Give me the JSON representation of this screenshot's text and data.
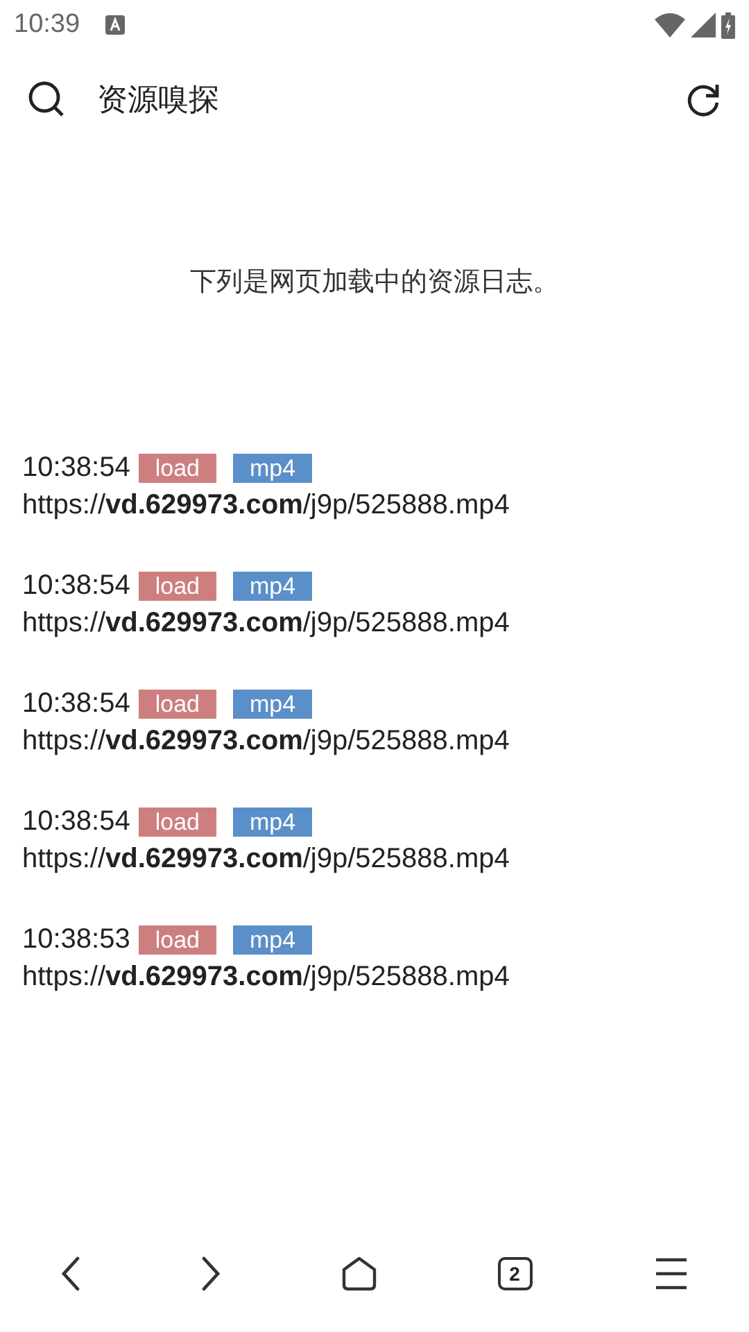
{
  "status_bar": {
    "time": "10:39"
  },
  "header": {
    "title": "资源嗅探"
  },
  "intro": "下列是网页加载中的资源日志。",
  "entries": [
    {
      "time": "10:38:54",
      "tags": [
        {
          "label": "load",
          "color": "#cd7f80"
        },
        {
          "label": "mp4",
          "color": "#5b8fc9"
        }
      ],
      "url": "https://**vd.629973.com**/j9p/525888.mp4"
    },
    {
      "time": "10:38:54",
      "tags": [
        {
          "label": "load",
          "color": "#cd7f80"
        },
        {
          "label": "mp4",
          "color": "#5b8fc9"
        }
      ],
      "url": "https://**vd.629973.com**/j9p/525888.mp4"
    },
    {
      "time": "10:38:54",
      "tags": [
        {
          "label": "load",
          "color": "#cd7f80"
        },
        {
          "label": "mp4",
          "color": "#5b8fc9"
        }
      ],
      "url": "https://**vd.629973.com**/j9p/525888.mp4"
    },
    {
      "time": "10:38:54",
      "tags": [
        {
          "label": "load",
          "color": "#cd7f80"
        },
        {
          "label": "mp4",
          "color": "#5b8fc9"
        }
      ],
      "url": "https://**vd.629973.com**/j9p/525888.mp4"
    },
    {
      "time": "10:38:53",
      "tags": [
        {
          "label": "load",
          "color": "#cd7f80"
        },
        {
          "label": "mp4",
          "color": "#5b8fc9"
        }
      ],
      "url": "https://**vd.629973.com**/j9p/525888.mp4"
    }
  ],
  "bottom_nav": {
    "tab_count": "2"
  }
}
